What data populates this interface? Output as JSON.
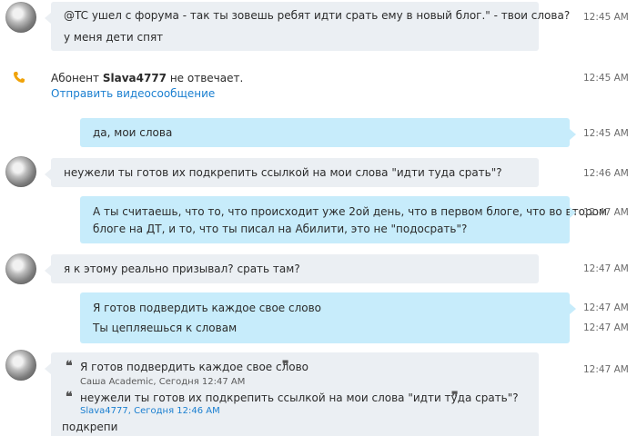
{
  "messages": [
    {
      "lines": [
        "@TC ушел с форума - так ты зовешь ребят идти срать ему в новый блог.\"  - твои слова?",
        "у меня дети спят"
      ],
      "time": "12:45 AM"
    },
    {
      "call_prefix": "Абонент ",
      "call_name": "Slava4777",
      "call_suffix": " не отвечает.",
      "call_link": "Отправить видеосообщение",
      "time": "12:45 AM",
      "icon": "phone-icon"
    },
    {
      "lines": [
        "да, мои слова"
      ],
      "time": "12:45 AM"
    },
    {
      "lines": [
        "неужели ты готов их подкрепить ссылкой на мои слова \"идти туда срать\"?"
      ],
      "time": "12:46 AM"
    },
    {
      "lines": [
        "А ты считаешь, что то, что происходит уже 2ой день, что в первом блоге, что во втором",
        "блоге на ДТ, и то, что ты писал на Абилити, это не \"подосрать\"?"
      ],
      "time": "12:47 AM"
    },
    {
      "lines": [
        "я к этому реально призывал? срать там?"
      ],
      "time": "12:47 AM"
    },
    {
      "lines": [
        "Я готов подвердить каждое свое слово"
      ],
      "time": "12:47 AM"
    },
    {
      "lines": [
        "Ты цепляешься к словам"
      ],
      "time": "12:47 AM"
    },
    {
      "quotes": [
        {
          "text": "Я готов подвердить каждое свое слово",
          "meta": "Саша Academic, Сегодня 12:47 AM"
        },
        {
          "text": "неужели ты готов их подкрепить ссылкой на мои слова \"идти туда срать\"?",
          "meta": "Slava4777, Сегодня 12:46 AM"
        }
      ],
      "reply": "подкрепи",
      "time": "12:47 AM"
    }
  ],
  "quote_open": "❝",
  "quote_close": "❞"
}
